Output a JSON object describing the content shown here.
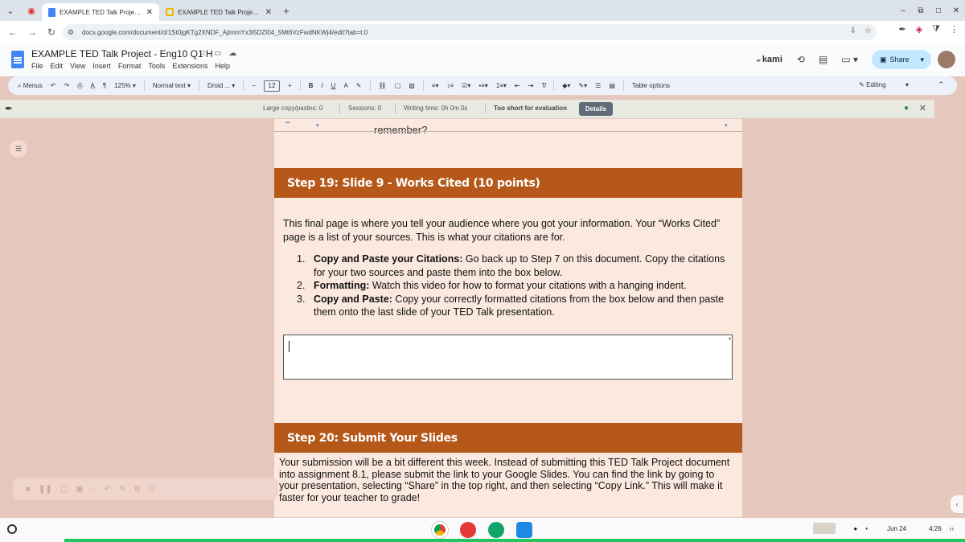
{
  "browser": {
    "tabs": [
      {
        "title": "EXAMPLE TED Talk Project - E",
        "active": true
      },
      {
        "title": "EXAMPLE TED Talk Project Sli",
        "active": false
      }
    ],
    "url": "docs.google.com/document/d/1St0jgKTg2XNDF_AjtmmYx3i5DZI04_5Mt6VzFwdNKWj4/edit?tab=t.0"
  },
  "doc": {
    "title": "EXAMPLE TED Talk Project - Eng10 Q1 H",
    "menus": [
      "File",
      "Edit",
      "View",
      "Insert",
      "Format",
      "Tools",
      "Extensions",
      "Help"
    ],
    "kami_label": "kami",
    "share_label": "Share"
  },
  "toolbar": {
    "menus_label": "Menus",
    "zoom": "125%",
    "style": "Normal text",
    "font": "Droid ...",
    "font_size": "12",
    "table_options": "Table options",
    "mode": "Editing"
  },
  "extension": {
    "large_copy": "Large copy/pastes: 0",
    "sessions": "Sessions: 0",
    "writing_time": "Writing time: 0h 0m 0s",
    "status": "Too short for evaluation",
    "details": "Details"
  },
  "content": {
    "top_fragment": "remember?",
    "step19": {
      "heading": "Step 19: Slide 9 - Works Cited (10 points)",
      "intro": "This final page is where you tell your audience where you got your information. Your “Works Cited” page is a list of your sources. This is what your citations are for.",
      "items": [
        {
          "num": "1.",
          "bold": "Copy and Paste your Citations:",
          "text": " Go back up to Step 7 on this document. Copy the citations for your two sources and paste them into the box below."
        },
        {
          "num": "2.",
          "bold": "Formatting:",
          "text": " Watch this video for how to format your citations with a hanging indent."
        },
        {
          "num": "3.",
          "bold": "Copy and Paste:",
          "text": " Copy your correctly formatted citations from the box below and then paste them onto the last slide of your TED Talk presentation."
        }
      ]
    },
    "step20": {
      "heading": "Step 20: Submit Your Slides",
      "text": "Your submission will be a bit different this week. Instead of submitting this TED Talk Project document into assignment 8.1, please submit the link to your Google Slides. You can find the link by going to your presentation, selecting “Share” in the top right, and then selecting “Copy Link.” This will make it faster for your teacher to grade!"
    }
  },
  "shelf": {
    "date": "Jun 24",
    "time": "4:26"
  },
  "colors": {
    "step_header": "#b5581a",
    "page_bg": "#fbe9df",
    "share_btn": "#c2e7ff"
  }
}
